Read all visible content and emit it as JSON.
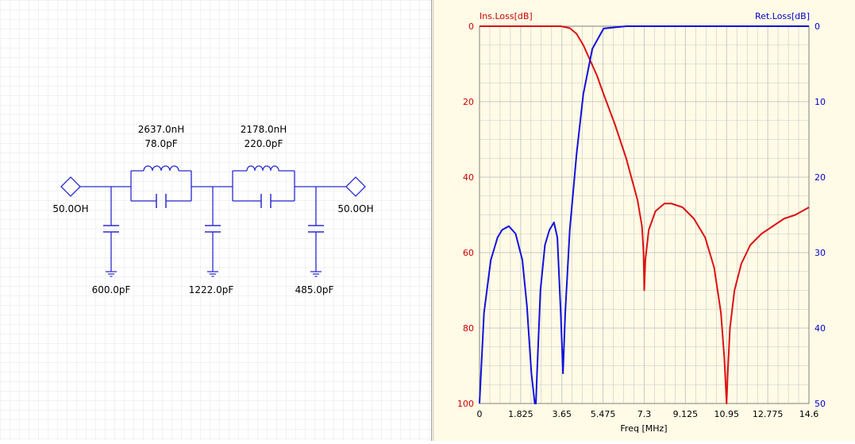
{
  "schematic": {
    "port_left_label": "50.0OH",
    "port_right_label": "50.0OH",
    "series_1": {
      "inductor": "2637.0nH",
      "capacitor": "78.0pF"
    },
    "series_2": {
      "inductor": "2178.0nH",
      "capacitor": "220.0pF"
    },
    "shunt_1": "600.0pF",
    "shunt_2": "1222.0pF",
    "shunt_3": "485.0pF"
  },
  "colors": {
    "wire": "#2b2bd0",
    "ins_loss": "#dd1111",
    "ret_loss": "#1111dd",
    "grid": "#c8c8c8",
    "chart_bg": "#fffbe6"
  },
  "chart_data": {
    "type": "line",
    "xlabel": "Freq [MHz]",
    "ylabel_left": "Ins.Loss[dB]",
    "ylabel_right": "Ret.Loss[dB]",
    "xlim": [
      0,
      14.6
    ],
    "ylim_left": [
      0,
      100
    ],
    "ylim_right": [
      0,
      50
    ],
    "y_inverted": true,
    "grid": true,
    "x_ticks": [
      "0",
      "1.825",
      "3.65",
      "5.475",
      "7.3",
      "9.125",
      "10.95",
      "12.775",
      "14.6"
    ],
    "y_ticks_left": [
      "0",
      "20",
      "40",
      "60",
      "80",
      "100"
    ],
    "y_ticks_right": [
      "0",
      "10",
      "20",
      "30",
      "40",
      "50"
    ],
    "series": [
      {
        "name": "Ins.Loss[dB]",
        "axis": "left",
        "color": "#dd1111",
        "x": [
          0,
          1.0,
          2.0,
          3.0,
          3.6,
          4.0,
          4.3,
          4.6,
          4.9,
          5.2,
          5.5,
          6.0,
          6.5,
          7.0,
          7.2,
          7.27,
          7.3,
          7.35,
          7.5,
          7.8,
          8.2,
          8.5,
          9.0,
          9.5,
          10.0,
          10.4,
          10.7,
          10.85,
          10.95,
          11.0,
          11.1,
          11.3,
          11.6,
          12.0,
          12.5,
          13.0,
          13.5,
          14.0,
          14.6
        ],
        "y": [
          0,
          0,
          0,
          0,
          0,
          0.5,
          2,
          5,
          9,
          13,
          18,
          26,
          35,
          46,
          53,
          60,
          70,
          62,
          54,
          49,
          47,
          47,
          48,
          51,
          56,
          64,
          76,
          88,
          100,
          92,
          80,
          70,
          63,
          58,
          55,
          53,
          51,
          50,
          48
        ]
      },
      {
        "name": "Ret.Loss[dB]",
        "axis": "right",
        "color": "#1111dd",
        "x": [
          0,
          0.2,
          0.5,
          0.8,
          1.0,
          1.3,
          1.6,
          1.9,
          2.1,
          2.3,
          2.45,
          2.5,
          2.55,
          2.7,
          2.9,
          3.1,
          3.3,
          3.45,
          3.6,
          3.7,
          3.8,
          4.0,
          4.3,
          4.6,
          5.0,
          5.5,
          6.5,
          8.0,
          10.0,
          12.0,
          14.6
        ],
        "y": [
          50,
          38,
          31,
          28,
          27,
          26.5,
          27.5,
          31,
          37,
          46,
          50,
          50,
          46,
          35,
          29,
          27,
          26,
          28,
          38,
          46,
          38,
          27,
          17,
          9,
          3,
          0.3,
          0,
          0,
          0,
          0,
          0
        ]
      }
    ]
  }
}
